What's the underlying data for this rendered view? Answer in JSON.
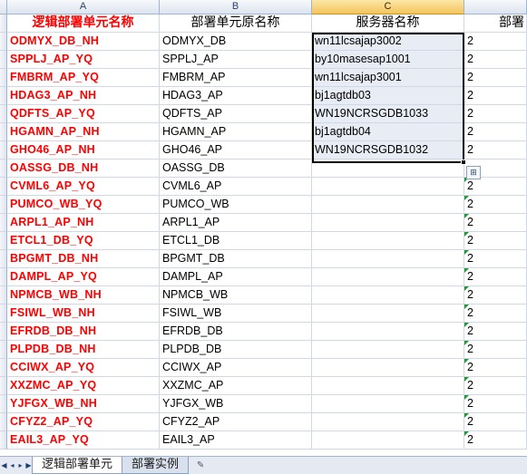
{
  "columns": [
    "A",
    "B",
    "C",
    ""
  ],
  "headers": {
    "logical_name": "逻辑部署单元名称",
    "original_name": "部署单元原名称",
    "server_name": "服务器名称",
    "d_partial": "部署"
  },
  "rows": [
    {
      "a": "ODMYX_DB_NH",
      "b": "ODMYX_DB",
      "c": "wn11lcsajap3002",
      "d": "2"
    },
    {
      "a": "SPPLJ_AP_YQ",
      "b": "SPPLJ_AP",
      "c": "by10masesap1001",
      "d": "2"
    },
    {
      "a": "FMBRM_AP_YQ",
      "b": "FMBRM_AP",
      "c": "wn11lcsajap3001",
      "d": "2"
    },
    {
      "a": "HDAG3_AP_NH",
      "b": "HDAG3_AP",
      "c": "bj1agtdb03",
      "d": "2"
    },
    {
      "a": "QDFTS_AP_YQ",
      "b": "QDFTS_AP",
      "c": "WN19NCRSGDB1033",
      "d": "2"
    },
    {
      "a": "HGAMN_AP_NH",
      "b": "HGAMN_AP",
      "c": "bj1agtdb04",
      "d": "2"
    },
    {
      "a": "GHO46_AP_NH",
      "b": "GHO46_AP",
      "c": "WN19NCRSGDB1032",
      "d": "2"
    },
    {
      "a": "OASSG_DB_NH",
      "b": "OASSG_DB",
      "c": "",
      "d": ""
    },
    {
      "a": "CVML6_AP_YQ",
      "b": "CVML6_AP",
      "c": "",
      "d": "2"
    },
    {
      "a": "PUMCO_WB_YQ",
      "b": "PUMCO_WB",
      "c": "",
      "d": "2"
    },
    {
      "a": "ARPL1_AP_NH",
      "b": "ARPL1_AP",
      "c": "",
      "d": "2"
    },
    {
      "a": "ETCL1_DB_YQ",
      "b": "ETCL1_DB",
      "c": "",
      "d": "2"
    },
    {
      "a": "BPGMT_DB_NH",
      "b": "BPGMT_DB",
      "c": "",
      "d": "2"
    },
    {
      "a": "DAMPL_AP_YQ",
      "b": "DAMPL_AP",
      "c": "",
      "d": "2"
    },
    {
      "a": "NPMCB_WB_NH",
      "b": "NPMCB_WB",
      "c": "",
      "d": "2"
    },
    {
      "a": "FSIWL_WB_NH",
      "b": "FSIWL_WB",
      "c": "",
      "d": "2"
    },
    {
      "a": "EFRDB_DB_NH",
      "b": "EFRDB_DB",
      "c": "",
      "d": "2"
    },
    {
      "a": "PLPDB_DB_NH",
      "b": "PLPDB_DB",
      "c": "",
      "d": "2"
    },
    {
      "a": "CCIWX_AP_YQ",
      "b": "CCIWX_AP",
      "c": "",
      "d": "2"
    },
    {
      "a": "XXZMC_AP_YQ",
      "b": "XXZMC_AP",
      "c": "",
      "d": "2"
    },
    {
      "a": "YJFGX_WB_NH",
      "b": "YJFGX_WB",
      "c": "",
      "d": "2"
    },
    {
      "a": "CFYZ2_AP_YQ",
      "b": "CFYZ2_AP",
      "c": "",
      "d": "2"
    },
    {
      "a": "EAIL3_AP_YQ",
      "b": "EAIL3_AP",
      "c": "",
      "d": "2"
    }
  ],
  "sheet_tabs": [
    "逻辑部署单元",
    "部署实例"
  ],
  "colors": {
    "accent_red": "#ff0000",
    "grid": "#d0d7e5",
    "header_bg": "#dde4ee",
    "selected_col": "#f4c45c",
    "error_triangle": "#1d9a3c"
  },
  "icons": [
    "first-sheet-icon",
    "prev-sheet-icon",
    "next-sheet-icon",
    "last-sheet-icon",
    "insert-sheet-icon",
    "paste-options-icon"
  ]
}
